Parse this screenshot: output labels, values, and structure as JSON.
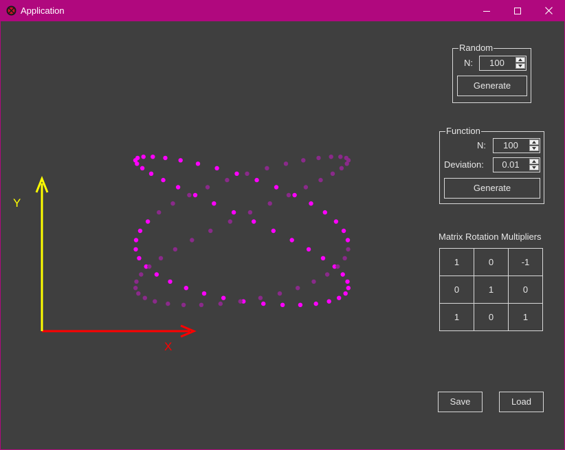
{
  "window": {
    "title": "Application",
    "controls": {
      "minimize": "minimize-icon",
      "maximize": "maximize-icon",
      "close": "close-icon"
    }
  },
  "axes": {
    "x_label": "X",
    "y_label": "Y",
    "x_color": "#ff0000",
    "y_color": "#ffff00"
  },
  "points": {
    "color_bright": "#ff00ff",
    "color_dim": "#8a2a8a"
  },
  "random": {
    "title": "Random",
    "n_label": "N:",
    "n_value": "100",
    "generate_label": "Generate"
  },
  "function": {
    "title": "Function",
    "n_label": "N:",
    "n_value": "100",
    "deviation_label": "Deviation:",
    "deviation_value": "0.01",
    "generate_label": "Generate"
  },
  "matrix": {
    "title": "Matrix Rotation Multipliers",
    "rows": [
      [
        "1",
        "0",
        "-1"
      ],
      [
        "0",
        "1",
        "0"
      ],
      [
        "1",
        "0",
        "1"
      ]
    ]
  },
  "actions": {
    "save_label": "Save",
    "load_label": "Load"
  }
}
